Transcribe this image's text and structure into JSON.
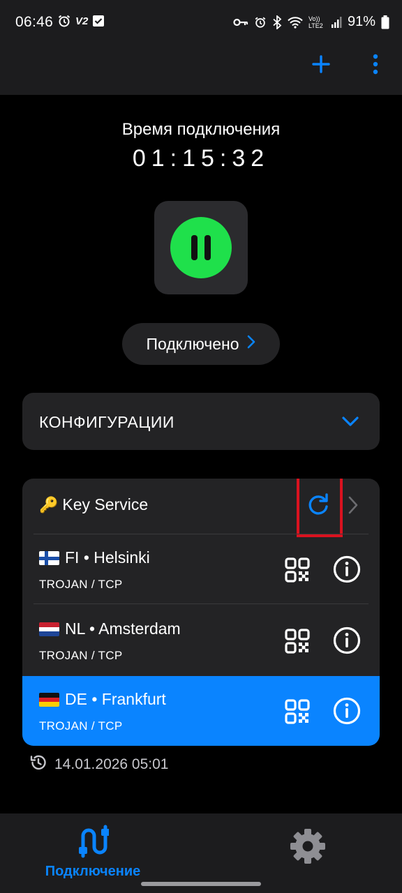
{
  "status_bar": {
    "time": "06:46",
    "v2_badge": "V2",
    "lte_label": "Vo)) LTE2",
    "battery": "91%"
  },
  "toolbar": {
    "add_icon": "plus-icon",
    "menu_icon": "more-vertical-icon"
  },
  "connection": {
    "time_label": "Время подключения",
    "elapsed": "01:15:32",
    "power_icon": "pause-icon",
    "state_label": "Подключено"
  },
  "configs": {
    "title": "КОНФИГУРАЦИИ"
  },
  "group": {
    "emoji": "🔑",
    "name": "Key Service"
  },
  "servers": [
    {
      "country": "FI",
      "city": "Helsinki",
      "name": "FI • Helsinki",
      "protocol": "TROJAN / TCP",
      "selected": false
    },
    {
      "country": "NL",
      "city": "Amsterdam",
      "name": "NL • Amsterdam",
      "protocol": "TROJAN / TCP",
      "selected": false
    },
    {
      "country": "DE",
      "city": "Frankfurt",
      "name": "DE • Frankfurt",
      "protocol": "TROJAN / TCP",
      "selected": true
    }
  ],
  "last_update": "14.01.2026 05:01",
  "nav": {
    "connect_label": "Подключение",
    "settings_icon": "gear-icon"
  },
  "colors": {
    "accent": "#0a84ff",
    "connected": "#1fe04b",
    "highlight": "#d9121f"
  }
}
